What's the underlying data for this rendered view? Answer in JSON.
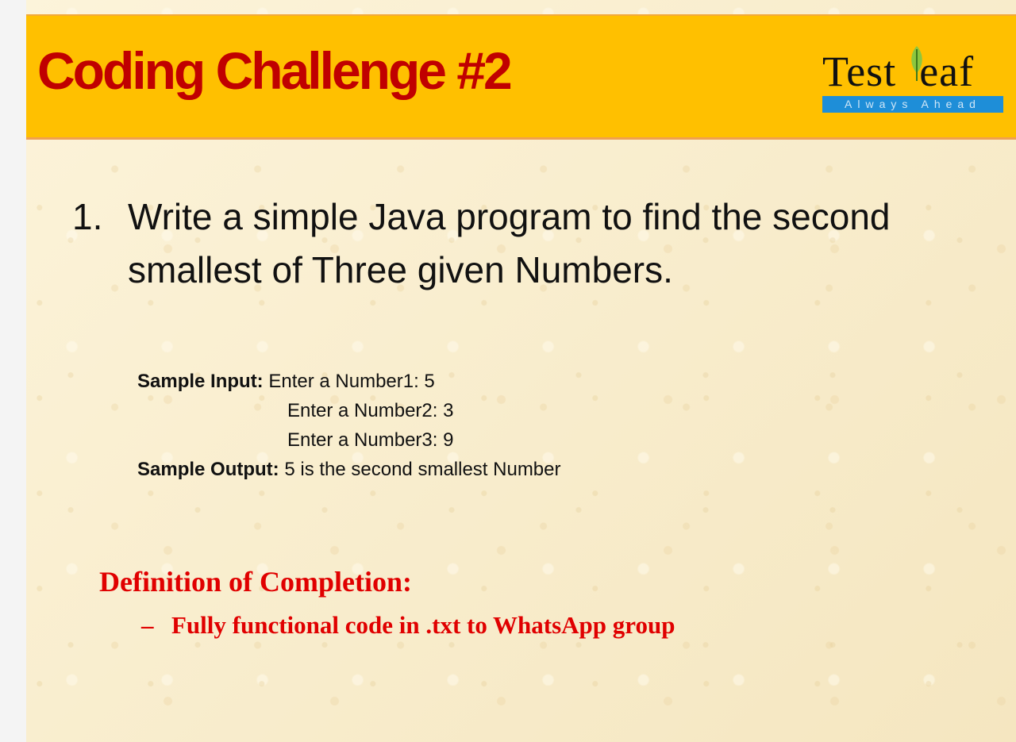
{
  "header": {
    "title": "Coding Challenge #2",
    "logo": {
      "name": "TestLeaf",
      "tagline": "Always Ahead"
    },
    "colors": {
      "background": "#ffc000",
      "title": "#c00000"
    }
  },
  "question": {
    "number": "1.",
    "text": "Write a simple Java program to find the second smallest of Three given Numbers."
  },
  "sample": {
    "input_label": "Sample Input:",
    "input_lines": [
      "Enter a Number1: 5",
      "Enter a Number2: 3",
      "Enter a Number3: 9"
    ],
    "output_label": "Sample Output:",
    "output_text": "5 is the second smallest Number"
  },
  "completion": {
    "heading": "Definition of Completion:",
    "bullet": "–",
    "items": [
      "Fully functional code in .txt to WhatsApp group"
    ],
    "color": "#e00000"
  }
}
